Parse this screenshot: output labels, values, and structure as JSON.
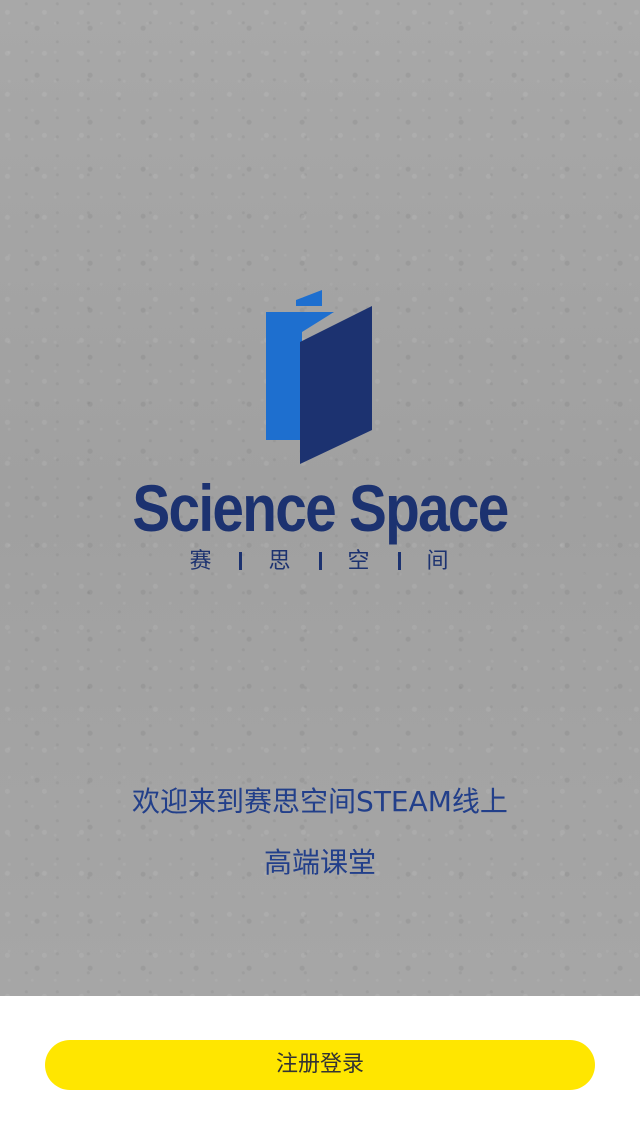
{
  "splash": {
    "brand_name": "Science Space",
    "brand_sub_chars": [
      "赛",
      "思",
      "空",
      "间"
    ],
    "welcome_line1": "欢迎来到赛思空间STEAM线上",
    "welcome_line2": "高端课堂"
  },
  "footer": {
    "login_label": "注册登录"
  },
  "icons": {
    "logo": "science-space-book-logo"
  },
  "colors": {
    "brand_dark_blue": "#1c3270",
    "brand_light_blue": "#1e6fcf",
    "button_yellow": "#ffe600",
    "background_gray": "#a3a3a3"
  }
}
